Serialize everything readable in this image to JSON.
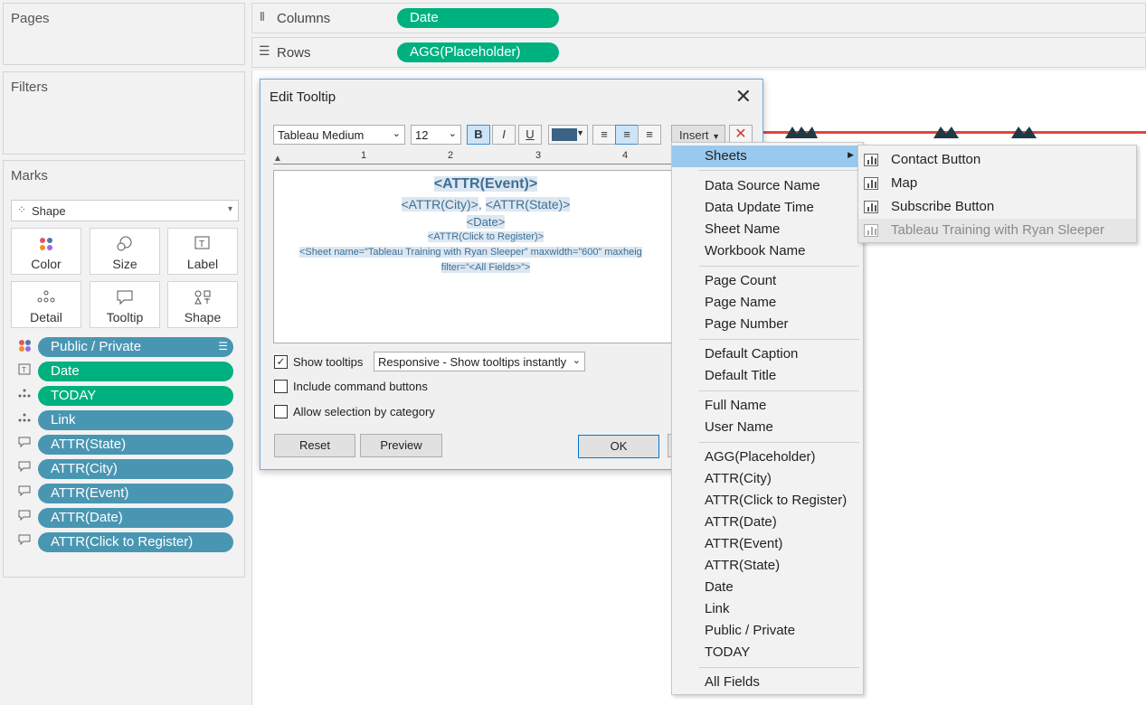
{
  "left_panels": {
    "pages_title": "Pages",
    "filters_title": "Filters",
    "marks_title": "Marks",
    "mark_type": "Shape",
    "cards": [
      "Color",
      "Size",
      "Label",
      "Detail",
      "Tooltip",
      "Shape"
    ],
    "mark_fields": [
      {
        "icon": "color-icon",
        "label": "Public / Private",
        "color": "#4996b2"
      },
      {
        "icon": "label-icon",
        "label": "Date",
        "color": "#00b180"
      },
      {
        "icon": "detail-icon",
        "label": "TODAY",
        "color": "#00b180"
      },
      {
        "icon": "detail-icon",
        "label": "Link",
        "color": "#4996b2"
      },
      {
        "icon": "tooltip-icon",
        "label": "ATTR(State)",
        "color": "#4996b2"
      },
      {
        "icon": "tooltip-icon",
        "label": "ATTR(City)",
        "color": "#4996b2"
      },
      {
        "icon": "tooltip-icon",
        "label": "ATTR(Event)",
        "color": "#4996b2"
      },
      {
        "icon": "tooltip-icon",
        "label": "ATTR(Date)",
        "color": "#4996b2"
      },
      {
        "icon": "tooltip-icon",
        "label": "ATTR(Click to Register)",
        "color": "#4996b2"
      }
    ]
  },
  "shelves": {
    "columns_label": "Columns",
    "columns_pill": "Date",
    "rows_label": "Rows",
    "rows_pill": "AGG(Placeholder)"
  },
  "dialog": {
    "title": "Edit Tooltip",
    "font": "Tableau Medium",
    "size": "12",
    "bold": "B",
    "italic": "I",
    "underline": "U",
    "insert_label": "Insert",
    "ruler": [
      "1",
      "2",
      "3",
      "4"
    ],
    "editor_lines": {
      "line1": "<ATTR(Event)>",
      "line2a": "<ATTR(City)>",
      "line2b": ", ",
      "line2c": "<ATTR(State)>",
      "line3": "<Date>",
      "line4": "<ATTR(Click to Register)>",
      "line5": "<Sheet name=”Tableau Training with Ryan Sleeper” maxwidth=”600” maxheig",
      "line6": "filter=”<All Fields>”>"
    },
    "show_tooltips_label": "Show tooltips",
    "show_tooltips_checked": true,
    "tooltip_mode": "Responsive - Show tooltips instantly",
    "include_command_label": "Include command buttons",
    "allow_selection_label": "Allow selection by category",
    "reset_label": "Reset",
    "preview_label": "Preview",
    "ok_label": "OK"
  },
  "insert_menu": {
    "sheets": "Sheets",
    "group1": [
      "Data Source Name",
      "Data Update Time",
      "Sheet Name",
      "Workbook Name"
    ],
    "group2": [
      "Page Count",
      "Page Name",
      "Page Number"
    ],
    "group3": [
      "Default Caption",
      "Default Title"
    ],
    "group4": [
      "Full Name",
      "User Name"
    ],
    "group5": [
      "AGG(Placeholder)",
      "ATTR(City)",
      "ATTR(Click to Register)",
      "ATTR(Date)",
      "ATTR(Event)",
      "ATTR(State)",
      "Date",
      "Link",
      "Public / Private",
      "TODAY"
    ],
    "all_fields": "All Fields"
  },
  "sheets_submenu": [
    "Contact Button",
    "Map",
    "Subscribe Button",
    "Tableau Training with Ryan Sleeper"
  ],
  "colors": {
    "accent_green": "#00b180",
    "accent_blue": "#4996b2",
    "line_red": "#e5453a",
    "shape_dark": "#1f3a44",
    "menu_highlight": "#99c9ef"
  }
}
